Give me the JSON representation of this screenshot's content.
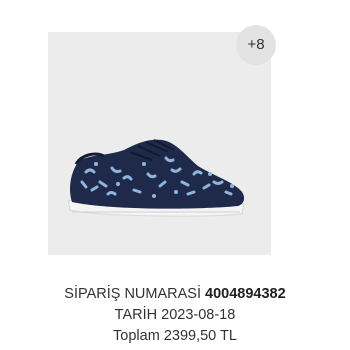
{
  "product": {
    "image_icon": "sneaker-image",
    "extra_items_badge": "+8"
  },
  "order": {
    "number_label": "SİPARİŞ NUMARASİ",
    "number_value": "4004894382",
    "date_label": "TARİH",
    "date_value": "2023-08-18",
    "total_label": "Toplam",
    "total_value": "2399,50 TL"
  },
  "colors": {
    "image_background": "#ececec",
    "badge_background": "#e3e3e3",
    "shoe_upper": "#1f2a4a",
    "shoe_pattern": "#8fb4dd",
    "sole": "#f2f2f2",
    "text": "#333333"
  }
}
